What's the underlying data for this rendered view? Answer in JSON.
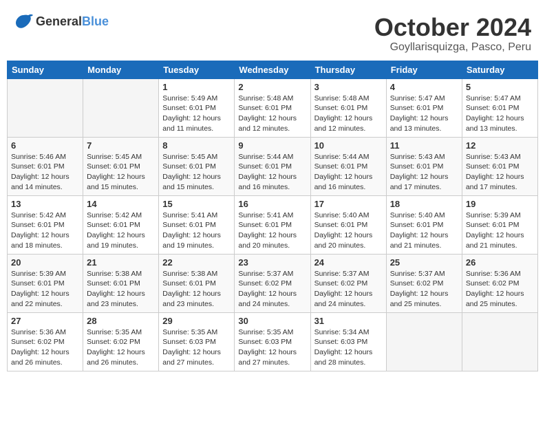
{
  "header": {
    "logo": {
      "general": "General",
      "blue": "Blue"
    },
    "title": "October 2024",
    "location": "Goyllarisquizga, Pasco, Peru"
  },
  "days_of_week": [
    "Sunday",
    "Monday",
    "Tuesday",
    "Wednesday",
    "Thursday",
    "Friday",
    "Saturday"
  ],
  "weeks": [
    [
      {
        "day": "",
        "empty": true
      },
      {
        "day": "",
        "empty": true
      },
      {
        "day": "1",
        "sunrise": "5:49 AM",
        "sunset": "6:01 PM",
        "daylight": "12 hours and 11 minutes."
      },
      {
        "day": "2",
        "sunrise": "5:48 AM",
        "sunset": "6:01 PM",
        "daylight": "12 hours and 12 minutes."
      },
      {
        "day": "3",
        "sunrise": "5:48 AM",
        "sunset": "6:01 PM",
        "daylight": "12 hours and 12 minutes."
      },
      {
        "day": "4",
        "sunrise": "5:47 AM",
        "sunset": "6:01 PM",
        "daylight": "12 hours and 13 minutes."
      },
      {
        "day": "5",
        "sunrise": "5:47 AM",
        "sunset": "6:01 PM",
        "daylight": "12 hours and 13 minutes."
      }
    ],
    [
      {
        "day": "6",
        "sunrise": "5:46 AM",
        "sunset": "6:01 PM",
        "daylight": "12 hours and 14 minutes."
      },
      {
        "day": "7",
        "sunrise": "5:45 AM",
        "sunset": "6:01 PM",
        "daylight": "12 hours and 15 minutes."
      },
      {
        "day": "8",
        "sunrise": "5:45 AM",
        "sunset": "6:01 PM",
        "daylight": "12 hours and 15 minutes."
      },
      {
        "day": "9",
        "sunrise": "5:44 AM",
        "sunset": "6:01 PM",
        "daylight": "12 hours and 16 minutes."
      },
      {
        "day": "10",
        "sunrise": "5:44 AM",
        "sunset": "6:01 PM",
        "daylight": "12 hours and 16 minutes."
      },
      {
        "day": "11",
        "sunrise": "5:43 AM",
        "sunset": "6:01 PM",
        "daylight": "12 hours and 17 minutes."
      },
      {
        "day": "12",
        "sunrise": "5:43 AM",
        "sunset": "6:01 PM",
        "daylight": "12 hours and 17 minutes."
      }
    ],
    [
      {
        "day": "13",
        "sunrise": "5:42 AM",
        "sunset": "6:01 PM",
        "daylight": "12 hours and 18 minutes."
      },
      {
        "day": "14",
        "sunrise": "5:42 AM",
        "sunset": "6:01 PM",
        "daylight": "12 hours and 19 minutes."
      },
      {
        "day": "15",
        "sunrise": "5:41 AM",
        "sunset": "6:01 PM",
        "daylight": "12 hours and 19 minutes."
      },
      {
        "day": "16",
        "sunrise": "5:41 AM",
        "sunset": "6:01 PM",
        "daylight": "12 hours and 20 minutes."
      },
      {
        "day": "17",
        "sunrise": "5:40 AM",
        "sunset": "6:01 PM",
        "daylight": "12 hours and 20 minutes."
      },
      {
        "day": "18",
        "sunrise": "5:40 AM",
        "sunset": "6:01 PM",
        "daylight": "12 hours and 21 minutes."
      },
      {
        "day": "19",
        "sunrise": "5:39 AM",
        "sunset": "6:01 PM",
        "daylight": "12 hours and 21 minutes."
      }
    ],
    [
      {
        "day": "20",
        "sunrise": "5:39 AM",
        "sunset": "6:01 PM",
        "daylight": "12 hours and 22 minutes."
      },
      {
        "day": "21",
        "sunrise": "5:38 AM",
        "sunset": "6:01 PM",
        "daylight": "12 hours and 23 minutes."
      },
      {
        "day": "22",
        "sunrise": "5:38 AM",
        "sunset": "6:01 PM",
        "daylight": "12 hours and 23 minutes."
      },
      {
        "day": "23",
        "sunrise": "5:37 AM",
        "sunset": "6:02 PM",
        "daylight": "12 hours and 24 minutes."
      },
      {
        "day": "24",
        "sunrise": "5:37 AM",
        "sunset": "6:02 PM",
        "daylight": "12 hours and 24 minutes."
      },
      {
        "day": "25",
        "sunrise": "5:37 AM",
        "sunset": "6:02 PM",
        "daylight": "12 hours and 25 minutes."
      },
      {
        "day": "26",
        "sunrise": "5:36 AM",
        "sunset": "6:02 PM",
        "daylight": "12 hours and 25 minutes."
      }
    ],
    [
      {
        "day": "27",
        "sunrise": "5:36 AM",
        "sunset": "6:02 PM",
        "daylight": "12 hours and 26 minutes."
      },
      {
        "day": "28",
        "sunrise": "5:35 AM",
        "sunset": "6:02 PM",
        "daylight": "12 hours and 26 minutes."
      },
      {
        "day": "29",
        "sunrise": "5:35 AM",
        "sunset": "6:03 PM",
        "daylight": "12 hours and 27 minutes."
      },
      {
        "day": "30",
        "sunrise": "5:35 AM",
        "sunset": "6:03 PM",
        "daylight": "12 hours and 27 minutes."
      },
      {
        "day": "31",
        "sunrise": "5:34 AM",
        "sunset": "6:03 PM",
        "daylight": "12 hours and 28 minutes."
      },
      {
        "day": "",
        "empty": true
      },
      {
        "day": "",
        "empty": true
      }
    ]
  ]
}
